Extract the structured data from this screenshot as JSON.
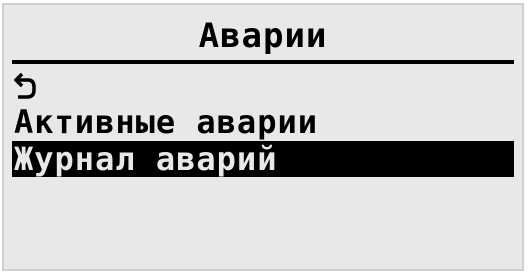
{
  "screen": {
    "title": "Аварии"
  },
  "menu": {
    "back_icon": "back-arrow-icon",
    "items": [
      {
        "label": "Активные аварии",
        "selected": false
      },
      {
        "label": "Журнал аварий",
        "selected": true
      }
    ]
  },
  "colors": {
    "background": "#e8e8e8",
    "foreground": "#000000",
    "highlight": "#000000"
  }
}
